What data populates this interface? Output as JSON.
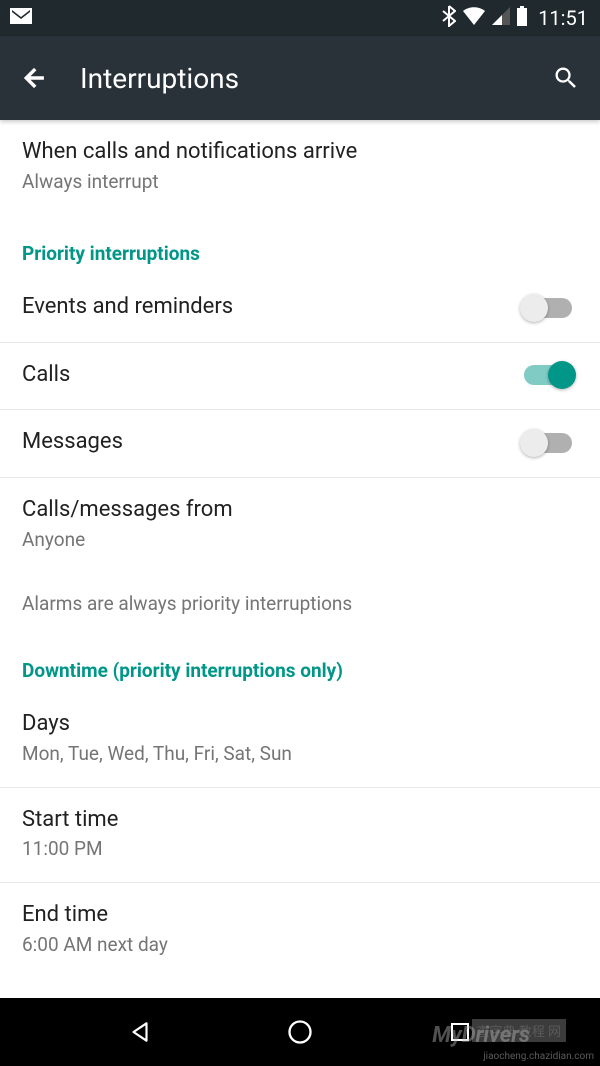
{
  "status_bar": {
    "time": "11:51"
  },
  "header": {
    "title": "Interruptions"
  },
  "settings": {
    "when_arrive": {
      "title": "When calls and notifications arrive",
      "value": "Always interrupt"
    },
    "section_priority": "Priority interruptions",
    "events_reminders": {
      "title": "Events and reminders",
      "enabled": false
    },
    "calls": {
      "title": "Calls",
      "enabled": true
    },
    "messages": {
      "title": "Messages",
      "enabled": false
    },
    "calls_from": {
      "title": "Calls/messages from",
      "value": "Anyone"
    },
    "alarms_info": "Alarms are always priority interruptions",
    "section_downtime": "Downtime (priority interruptions only)",
    "days": {
      "title": "Days",
      "value": "Mon, Tue, Wed, Thu, Fri, Sat, Sun"
    },
    "start_time": {
      "title": "Start time",
      "value": "11:00 PM"
    },
    "end_time": {
      "title": "End time",
      "value": "6:00 AM next day"
    }
  },
  "watermark": {
    "main": "MyDrivers",
    "ch": "查字典 教程 网",
    "url": "jiaocheng.chazidian.com"
  }
}
